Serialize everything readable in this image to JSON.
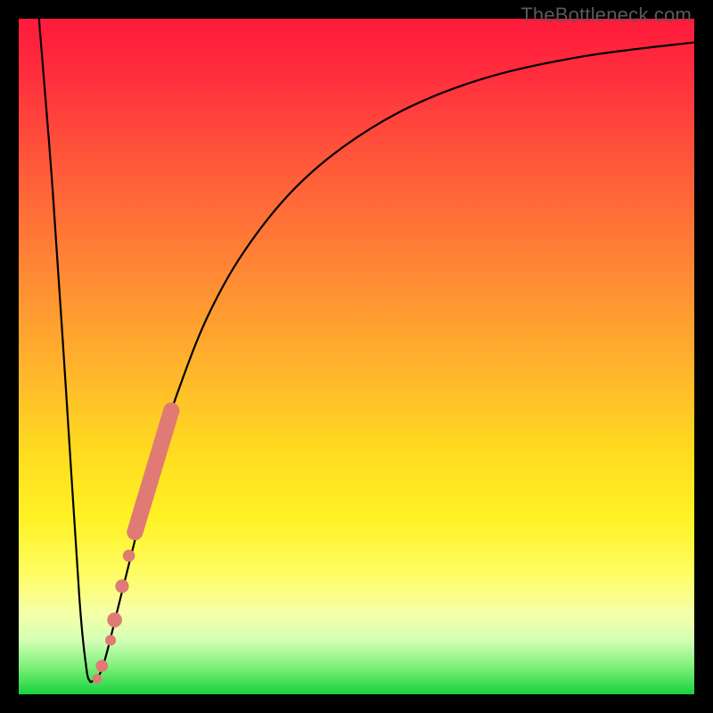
{
  "watermark": "TheBottleneck.com",
  "colors": {
    "frame": "#000000",
    "curve": "#000000",
    "marker": "#e07a74",
    "gradient_top": "#ff1a3c",
    "gradient_bottom": "#17d23d"
  },
  "chart_data": {
    "type": "line",
    "title": "",
    "xlabel": "",
    "ylabel": "",
    "xlim": [
      0,
      100
    ],
    "ylim": [
      0,
      100
    ],
    "grid": false,
    "legend": null,
    "series": [
      {
        "name": "bottleneck-curve",
        "x": [
          3,
          5,
          7,
          9,
          10,
          10.5,
          11,
          12,
          13,
          15,
          17,
          20,
          24,
          28,
          33,
          40,
          48,
          58,
          70,
          84,
          100
        ],
        "y": [
          100,
          75,
          45,
          14,
          4,
          2,
          2,
          3,
          6,
          14,
          22,
          34,
          46,
          56,
          65,
          74,
          81,
          87,
          91.5,
          94.5,
          96.5
        ]
      }
    ],
    "markers": [
      {
        "name": "highlighted-segment-thick",
        "type": "segment",
        "x0": 17.2,
        "y0": 24,
        "x1": 22.6,
        "y1": 42,
        "width": 2.4
      },
      {
        "name": "marker-dot-1",
        "type": "dot",
        "x": 16.3,
        "y": 20.5,
        "r": 0.9
      },
      {
        "name": "marker-dot-2",
        "type": "dot",
        "x": 15.3,
        "y": 16,
        "r": 1.0
      },
      {
        "name": "marker-dot-3",
        "type": "dot",
        "x": 14.2,
        "y": 11,
        "r": 1.1
      },
      {
        "name": "marker-dot-4",
        "type": "dot",
        "x": 13.6,
        "y": 8,
        "r": 0.8
      },
      {
        "name": "marker-dot-5",
        "type": "dot",
        "x": 12.3,
        "y": 4.2,
        "r": 0.9
      },
      {
        "name": "marker-dot-6",
        "type": "dot",
        "x": 11.6,
        "y": 2.3,
        "r": 0.7
      }
    ]
  }
}
